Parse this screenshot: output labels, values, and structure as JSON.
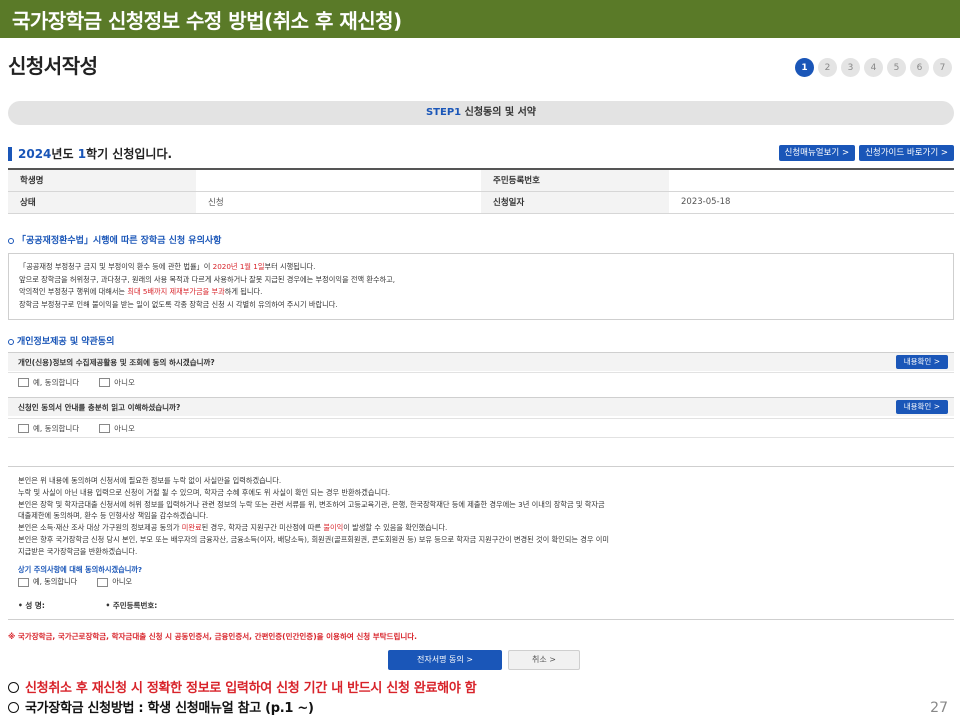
{
  "banner": {
    "title": "국가장학금 신청정보 수정 방법(취소 후 재신청)"
  },
  "page_title": "신청서작성",
  "steps": [
    "1",
    "2",
    "3",
    "4",
    "5",
    "6",
    "7"
  ],
  "step_bar": {
    "step": "STEP1",
    "label": "신청동의 및 서약"
  },
  "term": {
    "year": "2024",
    "year_suffix": "년도",
    "term_no": "1",
    "term_suffix": "학기 신청입니다."
  },
  "top_buttons": {
    "manual": "신청매뉴얼보기 >",
    "guide": "신청가이드 바로가기 >"
  },
  "info_table": {
    "student_name_label": "학생명",
    "student_name": "",
    "rrn_label": "주민등록번호",
    "rrn": "",
    "status_label": "상태",
    "status": "신청",
    "apply_date_label": "신청일자",
    "apply_date": "2023-05-18"
  },
  "public_finance": {
    "title_prefix": "「공공재정환수법」",
    "title_rest": "시행에 따른 장학금 신청 유의사항",
    "line1_a": "「공공재정 부정청구 금지 및 부정이익 환수 등에 관한 법률」이 ",
    "line1_date": "2020년 1월 1일",
    "line1_b": "부터 시행됩니다.",
    "line2": "앞으로 장학금을 허위청구, 과다청구, 원래의 사용 목적과 다르게 사용하거나 잘못 지급된 경우에는 부정이익을 전액 환수하고,",
    "line3_a": "악의적인 부정청구 행위에 대해서는 ",
    "line3_red": "최대 5배까지 제재부가금을 부과",
    "line3_b": "하게 됩니다.",
    "line4": "장학금 부정청구로 인해 불이익을 받는 일이 없도록 각종 장학금 신청 시 각별히 유의하여 주시기 바랍니다."
  },
  "privacy": {
    "title": "개인정보제공 및 약관동의",
    "q1": "개인(신용)정보의 수집제공활용 및 조회에 동의 하시겠습니까?",
    "q2": "신청인 동의서 안내를 충분히 읽고 이해하셨습니까?",
    "detail_btn": "내용확인 >",
    "agree": "예, 동의합니다",
    "disagree": "아니오"
  },
  "agreement": {
    "line1": "본인은 위 내용에 동의하며 신청서에 필요한 정보를 누락 없이 사실만을 입력하겠습니다.",
    "line2": "누락 및 사실이 아닌 내용 입력으로 신청이 거절 될 수 있으며, 학자금 수혜 후에도 위 사실이 확인 되는 경우 반환하겠습니다.",
    "line3": "본인은 장학 및 학자금대출 신청서에 허위 정보를 입력하거나 관련 정보의 누락 또는 관련 서류를 위, 변조하여 고등교육기관, 은행, 한국장학재단 등에 제출한 경우에는 3년 이내의 장학금 및 학자금",
    "line4": "대출제한에 동의하며, 환수 등 민형사상 책임을 감수하겠습니다.",
    "line5_a": "본인은 소득·재산 조사 대상 가구원의 정보제공 동의가 ",
    "line5_red1": "미완료",
    "line5_b": "된 경우, 학자금 지원구간 미산정에 따른 ",
    "line5_red2": "불이익",
    "line5_c": "이 발생할 수 있음을 확인했습니다.",
    "line6": "본인은 향후 국가장학금 신청 당시 본인, 부모 또는 배우자의 금융자산, 금융소득(이자, 배당소득), 회원권(골프회원권, 콘도회원권 등) 보유 등으로 학자금 지원구간이 변경된 것이 확인되는 경우 이미",
    "line7": "지급받은 국가장학금을 반환하겠습니다.",
    "question": "상기 주의사항에 대해 동의하시겠습니까?",
    "agree": "예, 동의합니다",
    "disagree": "아니오"
  },
  "sign": {
    "name_label": "• 성 명:",
    "rrn_label": "• 주민등록번호:"
  },
  "cert_notice": "※ 국가장학금, 국가근로장학금, 학자금대출 신청 시 공동인증서, 금융인증서, 간편인증(민간인증)을 이용하여 신청 부탁드립니다.",
  "actions": {
    "sign": "전자서명 동의  >",
    "cancel": "취소  >"
  },
  "footer": {
    "line1": "신청취소 후 재신청 시 정확한 정보로 입력하여 신청 기간 내 반드시 신청 완료해야 함",
    "line2": "국가장학금 신청방법 : 학생 신청매뉴얼 참고 (p.1 ~)"
  },
  "page_number": "27",
  "colors": {
    "banner": "#5a7a28",
    "accent_blue": "#1a56b8",
    "accent_red": "#d8232a"
  }
}
